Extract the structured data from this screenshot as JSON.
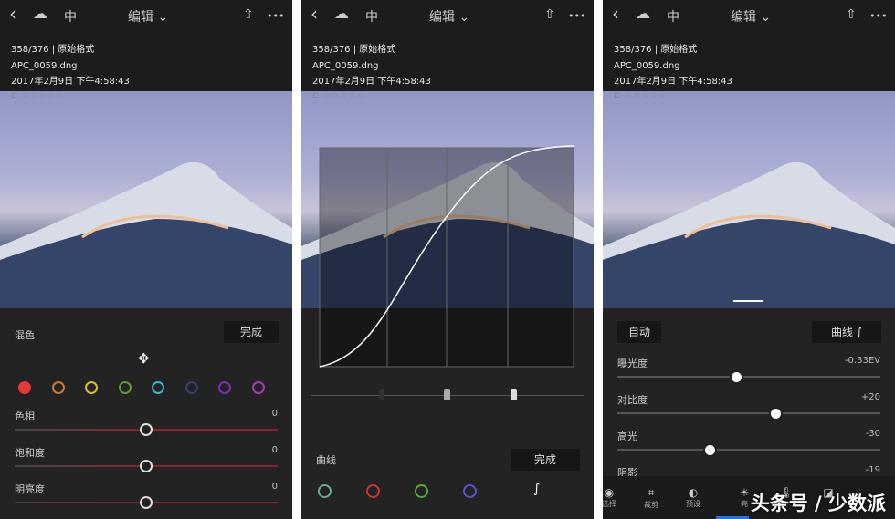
{
  "header": {
    "title": "编辑 ⌄",
    "cloud": "☁",
    "lang": "中",
    "back": "‹",
    "share": "⇧",
    "more": "•••"
  },
  "info": {
    "counter": "358/376 | 原始格式",
    "filename": "APC_0059.dng",
    "datetime": "2017年2月9日 下午4:58:43",
    "rating": "⊏ ☆☆☆☆☆"
  },
  "mix": {
    "title": "混色",
    "done": "完成",
    "target": "✥",
    "colors": [
      "#e53935",
      "#c77a3a",
      "#d4c12a",
      "#5a9a3a",
      "#3fb3c8",
      "#3a3f6a",
      "#7b2fb0",
      "#a43ab0"
    ],
    "sliders": [
      {
        "label": "色相",
        "value": "0",
        "pos": 0.5
      },
      {
        "label": "饱和度",
        "value": "0",
        "pos": 0.5
      },
      {
        "label": "明亮度",
        "value": "0",
        "pos": 0.5
      }
    ]
  },
  "curve": {
    "title": "曲线",
    "done": "完成",
    "channels": [
      "#6a9",
      "#c33",
      "#5a3",
      "#55c"
    ]
  },
  "light": {
    "auto": "自动",
    "curve_btn": "曲线 ∫",
    "sliders": [
      {
        "label": "曝光度",
        "value": "-0.33EV",
        "pos": 0.45
      },
      {
        "label": "对比度",
        "value": "+20",
        "pos": 0.6
      },
      {
        "label": "高光",
        "value": "-30",
        "pos": 0.35
      },
      {
        "label": "阴影",
        "value": "-19"
      }
    ],
    "tools": [
      "选择",
      "裁剪",
      "预设",
      "亮",
      "",
      ""
    ]
  },
  "watermark": "头条号 / 少数派"
}
